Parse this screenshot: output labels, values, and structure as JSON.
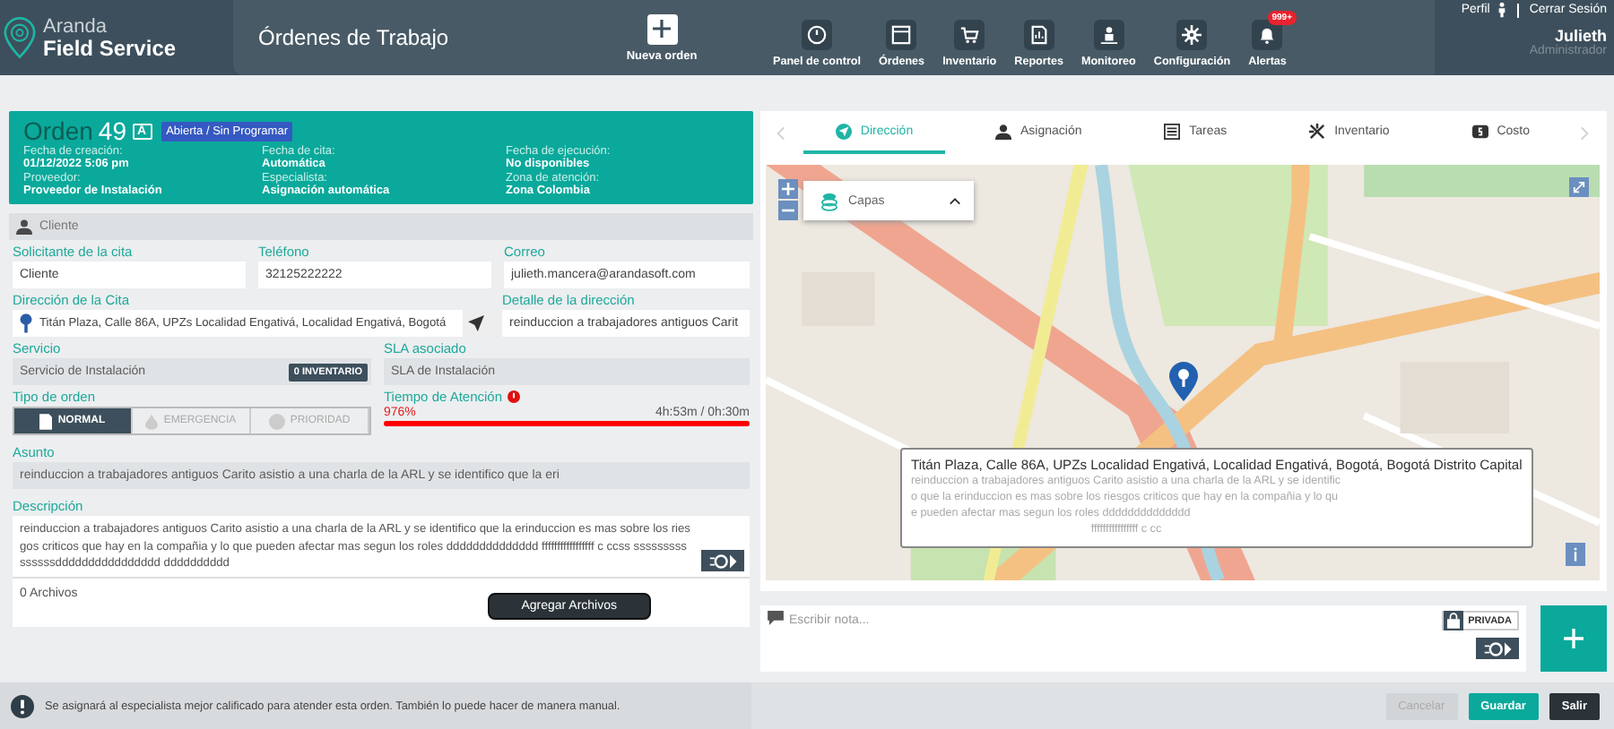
{
  "header": {
    "logo_top": "Aranda",
    "logo_bottom": "Field Service",
    "page_title": "Órdenes de Trabajo",
    "new_order": "Nueva orden",
    "nav": [
      {
        "label": "Panel de control",
        "kind": "gauge"
      },
      {
        "label": "Órdenes",
        "kind": "window"
      },
      {
        "label": "Inventario",
        "kind": "cart"
      },
      {
        "label": "Reportes",
        "kind": "report"
      },
      {
        "label": "Monitoreo",
        "kind": "person"
      },
      {
        "label": "Configuración",
        "kind": "gear"
      },
      {
        "label": "Alertas",
        "kind": "bell",
        "badge": "999+"
      }
    ],
    "profile": "Perfil",
    "logout": "Cerrar Sesión",
    "user": "Julieth",
    "role": "Administrador"
  },
  "order": {
    "title": "Orden",
    "number": "49",
    "letter": "A",
    "status": "Abierta / Sin Programar",
    "details": [
      {
        "label": "Fecha de creación:",
        "value": "01/12/2022 5:06 pm"
      },
      {
        "label": "Fecha de cita:",
        "value": "Automática"
      },
      {
        "label": "Fecha de ejecución:",
        "value": "No disponibles"
      },
      {
        "label": "Proveedor:",
        "value": "Proveedor de Instalación"
      },
      {
        "label": "Especialista:",
        "value": "Asignación automática"
      },
      {
        "label": "Zona de atención:",
        "value": "Zona Colombia"
      }
    ]
  },
  "client_section": "Cliente",
  "contact": [
    {
      "label": "Solicitante de la cita",
      "value": "Cliente"
    },
    {
      "label": "Teléfono",
      "value": "32125222222"
    },
    {
      "label": "Correo",
      "value": "julieth.mancera@arandasoft.com"
    }
  ],
  "address": {
    "label": "Dirección de la Cita",
    "value": "Titán Plaza, Calle 86A, UPZs Localidad Engativá, Localidad Engativá, Bogotá",
    "detail_label": "Detalle de la dirección",
    "detail_value": "reinduccion a trabajadores antiguos Carit"
  },
  "service": {
    "label": "Servicio",
    "value": "Servicio de Instalación",
    "inventory_badge": "0 INVENTARIO",
    "sla_label": "SLA asociado",
    "sla_value": "SLA de Instalación"
  },
  "order_type": {
    "label": "Tipo de orden",
    "options": [
      {
        "label": "NORMAL",
        "selected": true,
        "kind": "doc"
      },
      {
        "label": "EMERGENCIA",
        "selected": false,
        "kind": "drop"
      },
      {
        "label": "PRIORIDAD",
        "selected": false,
        "kind": "alert"
      }
    ]
  },
  "attention": {
    "label": "Tiempo de Atención",
    "percent": "976%",
    "time": "4h:53m / 0h:30m",
    "level": 1
  },
  "subject": {
    "label": "Asunto",
    "value": "reinduccion a trabajadores antiguos Carito asistio a una charla de la ARL y se identifico que la eri"
  },
  "description": {
    "label": "Descripción",
    "value": "reinduccion a trabajadores antiguos Carito asistio a una charla de la ARL y se identifico que la erinduccion es mas sobre los riesgos criticos que hay en la compañia y lo que pueden afectar mas segun los roles dddddddddddddd fffffffffffffffff c ccss sssssssssssssssdddddddddddddddd dddddddddd"
  },
  "attachments": {
    "count": "0 Archivos",
    "button": "Agregar Archivos"
  },
  "tabs": [
    {
      "label": "Dirección",
      "selected": true,
      "kind": "nav"
    },
    {
      "label": "Asignación",
      "selected": false,
      "kind": "user"
    },
    {
      "label": "Tareas",
      "selected": false,
      "kind": "list"
    },
    {
      "label": "Inventario",
      "selected": false,
      "kind": "tools"
    },
    {
      "label": "Costo",
      "selected": false,
      "kind": "money"
    }
  ],
  "map": {
    "kind": "picture",
    "layers": "Capas",
    "popup_title": "Titán Plaza, Calle 86A, UPZs Localidad Engativá, Localidad Engativá, Bogotá, Bogotá Distrito Capital",
    "popup_text": "reinduccion a trabajadores antiguos Carito asistio a una charla de la ARL y se identifico que la erinduccion es mas sobre los riesgos criticos que hay en la compañia y lo que pueden afectar mas segun los roles dddddddddddddd",
    "popup_tail": "ffffffffffffffff c cc"
  },
  "note": {
    "placeholder": "Escribir nota...",
    "private": "PRIVADA"
  },
  "footer": {
    "message": "Se asignará al especialista mejor calificado para atender esta orden. También lo puede hacer de manera manual.",
    "buttons": [
      {
        "label": "Cancelar",
        "kind": "disabled"
      },
      {
        "label": "Guardar",
        "kind": "primary"
      },
      {
        "label": "Salir",
        "kind": "dark"
      }
    ]
  }
}
